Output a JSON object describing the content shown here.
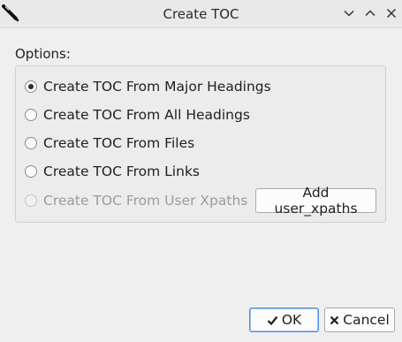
{
  "window": {
    "title": "Create TOC",
    "app_icon": "pen-icon",
    "controls": [
      "minimize-icon",
      "maximize-icon",
      "close-icon"
    ]
  },
  "options": {
    "label": "Options:",
    "radios": [
      {
        "label": "Create TOC From Major Headings",
        "checked": true,
        "enabled": true
      },
      {
        "label": "Create TOC From All Headings",
        "checked": false,
        "enabled": true
      },
      {
        "label": "Create TOC From Files",
        "checked": false,
        "enabled": true
      },
      {
        "label": "Create TOC From Links",
        "checked": false,
        "enabled": true
      },
      {
        "label": "Create TOC From User Xpaths",
        "checked": false,
        "enabled": false
      }
    ],
    "add_button_label": "Add user_xpaths"
  },
  "buttons": {
    "ok_label": "OK",
    "ok_icon": "check-icon",
    "cancel_label": "Cancel",
    "cancel_icon": "x-icon"
  }
}
